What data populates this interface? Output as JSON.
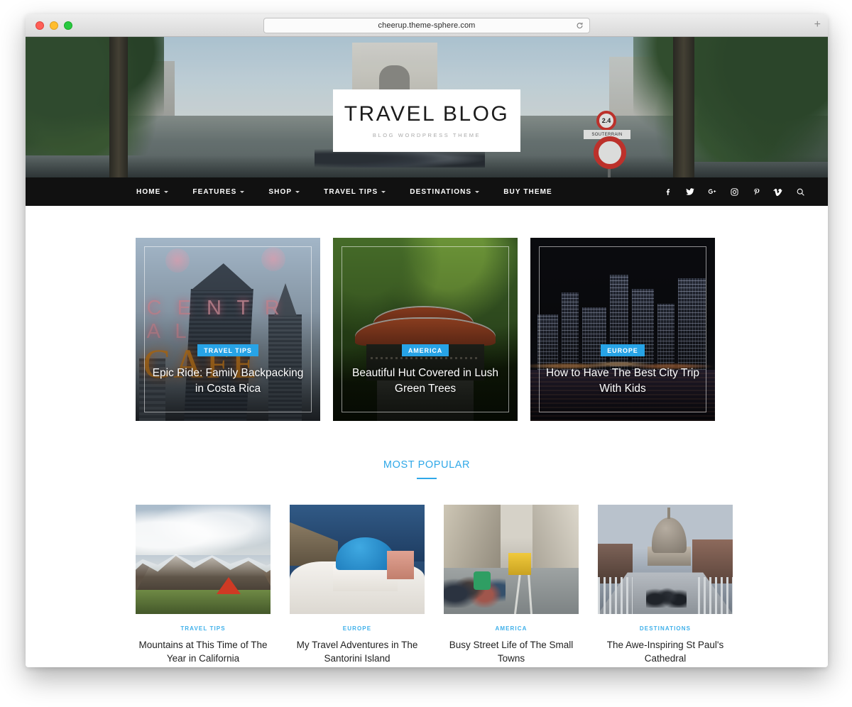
{
  "browser": {
    "url": "cheerup.theme-sphere.com",
    "reload_icon": "reload-icon",
    "new_tab_label": "+"
  },
  "header": {
    "logo_title": "TRAVEL BLOG",
    "logo_tagline": "BLOG WORDPRESS THEME"
  },
  "nav": {
    "items": [
      {
        "label": "HOME",
        "has_dropdown": true
      },
      {
        "label": "FEATURES",
        "has_dropdown": true
      },
      {
        "label": "SHOP",
        "has_dropdown": true
      },
      {
        "label": "TRAVEL TIPS",
        "has_dropdown": true
      },
      {
        "label": "DESTINATIONS",
        "has_dropdown": true
      },
      {
        "label": "BUY THEME",
        "has_dropdown": false
      }
    ],
    "social": [
      {
        "name": "facebook-icon"
      },
      {
        "name": "twitter-icon"
      },
      {
        "name": "google-plus-icon"
      },
      {
        "name": "instagram-icon"
      },
      {
        "name": "pinterest-icon"
      },
      {
        "name": "vimeo-icon"
      },
      {
        "name": "search-icon"
      }
    ]
  },
  "featured": [
    {
      "badge": "TRAVEL TIPS",
      "title": "Epic Ride: Family Backpacking in Costa Rica",
      "image_desc": "neon Central Cafe sign over city skyscrapers",
      "neon_top": "C E N T R A L",
      "neon_bottom": "CAFE"
    },
    {
      "badge": "AMERICA",
      "title": "Beautiful Hut Covered in Lush Green Trees",
      "image_desc": "pagoda temple with terracotta roof in green forest"
    },
    {
      "badge": "EUROPE",
      "title": "How to Have The Best City Trip With Kids",
      "image_desc": "city skyline at night reflected in water"
    }
  ],
  "section": {
    "title": "MOST POPULAR"
  },
  "popular": [
    {
      "category": "TRAVEL TIPS",
      "title": "Mountains at This Time of The Year in California",
      "image_desc": "snowy mountain range with red tent on meadow"
    },
    {
      "category": "EUROPE",
      "title": "My Travel Adventures in The Santorini Island",
      "image_desc": "Santorini blue dome church above the sea"
    },
    {
      "category": "AMERICA",
      "title": "Busy Street Life of The Small Towns",
      "image_desc": "crowded narrow street with yellow tram"
    },
    {
      "category": "DESTINATIONS",
      "title": "The Awe-Inspiring St Paul's Cathedral",
      "image_desc": "St Paul's Cathedral seen from Millennium Bridge"
    }
  ],
  "colors": {
    "accent_blue": "#2fa8e8",
    "badge_blue": "#27a3e6",
    "nav_bg": "#111111",
    "text_dark": "#1f1f1f"
  },
  "hero": {
    "sign_speed": "2.4",
    "sign_plate": "SOUTERRAIN"
  }
}
